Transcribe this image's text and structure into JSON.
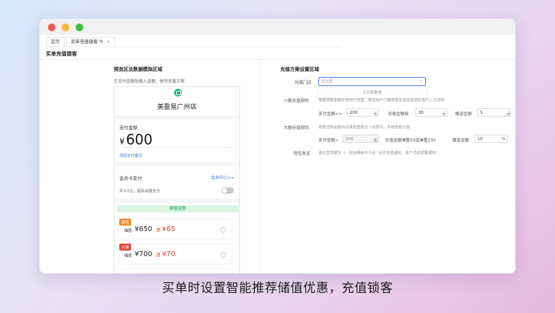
{
  "window": {
    "tabs": [
      {
        "label": "首页"
      },
      {
        "label": "买单充值锁客",
        "refresh_icon": "refresh-icon",
        "close_icon": "close-icon"
      }
    ],
    "page_title": "买单充值锁客"
  },
  "preview": {
    "title": "预览区及数据模拟区域",
    "hint": "在支付金额处输入金额，体验充值方案",
    "store_name": "美盈易广州店",
    "pay_label": "支付金额",
    "currency": "¥",
    "pay_amount": "600",
    "add_note": "添加支付备注",
    "member_card_label": "会员卡支付",
    "member_center_link": "会员中心>>",
    "balance_text": "共￥0元，使用余额支付",
    "stored_value_header": "储值金额",
    "offers": [
      {
        "badge": "超值",
        "badge_color": "#f08a24",
        "stored_label": "储值",
        "amount": "¥650",
        "gift_prefix": "送",
        "gift": "¥65"
      },
      {
        "badge": "火爆",
        "badge_color": "#e24a3b",
        "stored_label": "储值",
        "amount": "¥700",
        "gift_prefix": "送",
        "gift": "¥70"
      }
    ]
  },
  "settings": {
    "title": "充值方案设置区域",
    "store_label": "所属门店",
    "store_placeholder": "请选择",
    "store_dropdown_empty": "无匹配数据",
    "small_label": "小额充值规则",
    "small_desc": "根据消费金额补充进行充值，降低用户门槛将锁定会员及锁定客户二次消费",
    "small_pay_label": "支付金额<=",
    "small_pay_value": "200",
    "small_pay_unit": "元",
    "small_multiple_label": "充值金额按",
    "small_multiple_value": "30",
    "small_multiple_unit": "元",
    "small_gift_label": "赠送金额",
    "small_gift_value": "5",
    "small_gift_unit": "元",
    "large_label": "大额充值规则",
    "large_desc": "根据消费金额自动凑成整数且十或整百，系统智能计算",
    "large_pay_label": "支付金额>",
    "large_pay_value": "200",
    "large_pay_unit": "元",
    "large_round_label": "充值金额凑整50或凑整100",
    "large_gift_label": "赠送金额",
    "large_gift_value": "10",
    "large_gift_unit": "%",
    "sms_label": "短信发送",
    "sms_desc": "请在营销模块 -》 短信模板中开启 \"会员充值通知、客户消费提醒通知\""
  },
  "caption": "买单时设置智能推荐储值优惠，充值锁客",
  "colors": {
    "accent_blue": "#3b6fd8",
    "green": "#19b27b",
    "gift_red": "#e23b2e"
  }
}
